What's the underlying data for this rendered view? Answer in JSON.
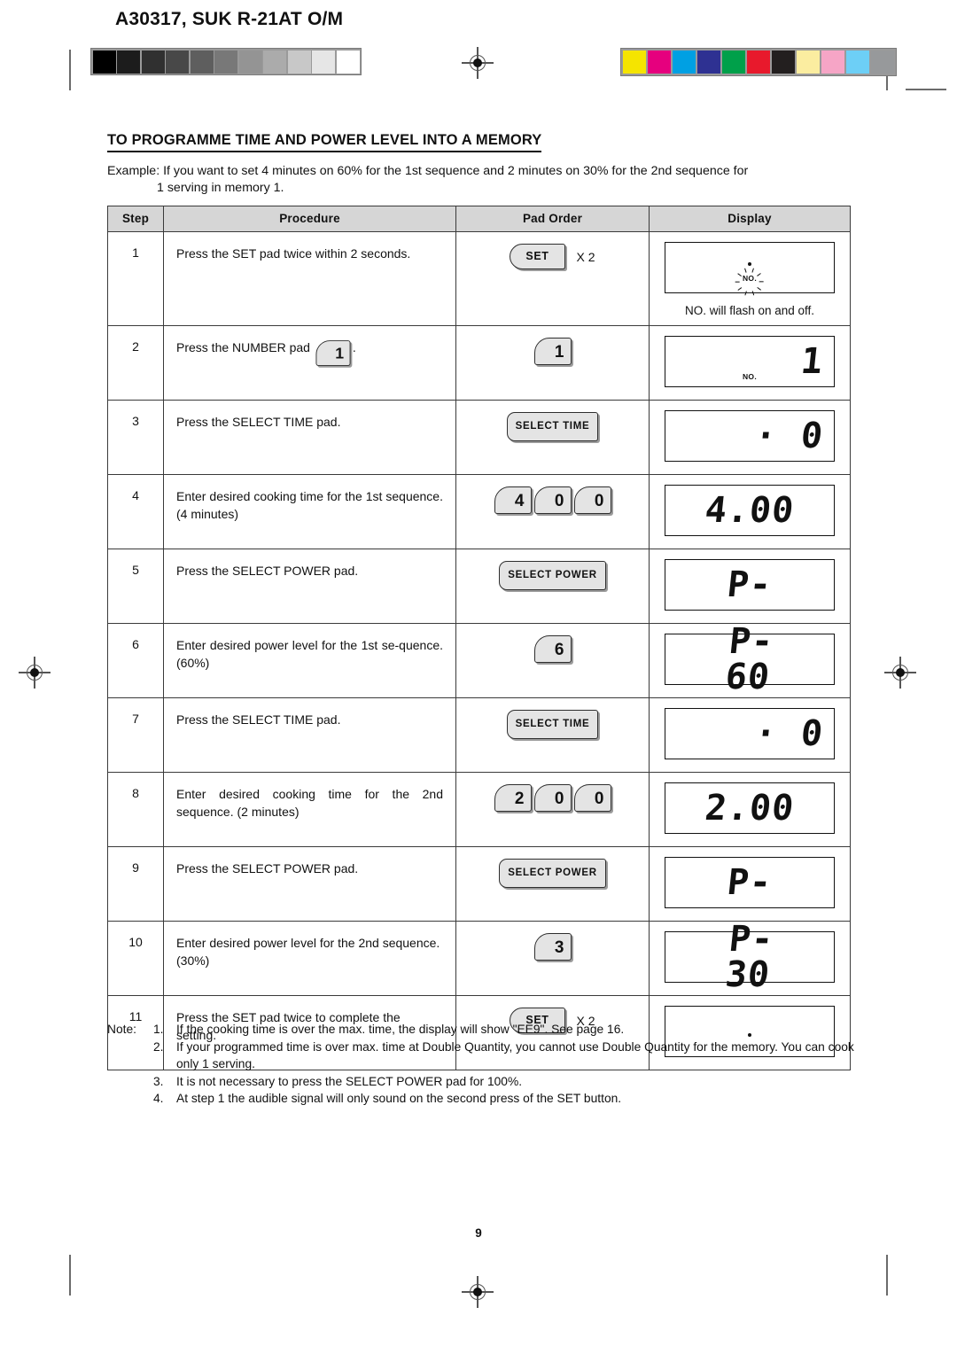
{
  "header": {
    "doc_number": "A30317, SUK R-21AT O/M",
    "page_number": "9"
  },
  "calibration": {
    "gray_patches": [
      "#000000",
      "#1c1c1c",
      "#303030",
      "#484848",
      "#5e5e5e",
      "#787878",
      "#949494",
      "#ababab",
      "#c8c8c8",
      "#e6e6e6",
      "#ffffff"
    ],
    "color_patches": [
      "#f5e400",
      "#e6007e",
      "#00a0e3",
      "#2e3192",
      "#00a04a",
      "#e8192c",
      "#231f1f",
      "#fbeda0",
      "#f6a5c6",
      "#6dcff6",
      "#97999b"
    ]
  },
  "title": "TO PROGRAMME TIME AND POWER LEVEL INTO A MEMORY",
  "example": {
    "line1": "Example: If you want to set 4 minutes on 60% for the 1st sequence and 2 minutes on 30% for the 2nd sequence for",
    "line2": "1 serving in memory 1."
  },
  "table": {
    "headers": [
      "Step",
      "Procedure",
      "Pad Order",
      "Display"
    ],
    "rows": [
      {
        "step": "1",
        "procedure": "Press the SET pad twice within 2 seconds.",
        "justify": false,
        "pad_kind": "set",
        "pad_label": "SET",
        "pad_multiplier": "X 2",
        "display_kind": "flash-no",
        "display_value": "",
        "display_no_label": "NO.",
        "display_caption": "NO. will flash on and off."
      },
      {
        "step": "2",
        "procedure_before": "Press the NUMBER pad",
        "procedure_after": ".",
        "inline_pad": "1",
        "justify": false,
        "pad_kind": "number",
        "pad_digits": [
          "1"
        ],
        "display_kind": "digits-no",
        "display_value": "1",
        "display_no_label": "NO."
      },
      {
        "step": "3",
        "procedure": "Press the SELECT TIME pad.",
        "justify": false,
        "pad_kind": "select",
        "pad_label": "SELECT TIME",
        "display_kind": "dot-digit",
        "display_value": "0"
      },
      {
        "step": "4",
        "procedure": "Enter desired cooking time for the 1st sequence. (4 minutes)",
        "justify": true,
        "pad_kind": "number",
        "pad_digits": [
          "4",
          "0",
          "0"
        ],
        "display_kind": "time",
        "display_value": "4.00"
      },
      {
        "step": "5",
        "procedure": "Press the SELECT POWER pad.",
        "justify": false,
        "pad_kind": "select",
        "pad_label": "SELECT POWER",
        "display_kind": "plain",
        "display_value": "P-"
      },
      {
        "step": "6",
        "procedure": "Enter desired power level for the 1st se-quence. (60%)",
        "justify": true,
        "pad_kind": "number",
        "pad_digits": [
          "6"
        ],
        "display_kind": "plain",
        "display_value": "P-60"
      },
      {
        "step": "7",
        "procedure": "Press the SELECT TIME pad.",
        "justify": false,
        "pad_kind": "select",
        "pad_label": "SELECT TIME",
        "display_kind": "dot-digit",
        "display_value": "0"
      },
      {
        "step": "8",
        "procedure": "Enter desired cooking time for the 2nd sequence. (2 minutes)",
        "justify": true,
        "pad_kind": "number",
        "pad_digits": [
          "2",
          "0",
          "0"
        ],
        "display_kind": "time",
        "display_value": "2.00"
      },
      {
        "step": "9",
        "procedure": "Press the SELECT POWER pad.",
        "justify": false,
        "pad_kind": "select",
        "pad_label": "SELECT POWER",
        "display_kind": "plain",
        "display_value": "P-"
      },
      {
        "step": "10",
        "procedure": "Enter desired power level for the 2nd sequence. (30%)",
        "justify": false,
        "pad_kind": "number",
        "pad_digits": [
          "3"
        ],
        "display_kind": "plain",
        "display_value": "P-30"
      },
      {
        "step": "11",
        "procedure": "Press the SET pad twice to complete the setting.",
        "justify": false,
        "pad_kind": "set",
        "pad_label": "SET",
        "pad_multiplier": "X 2",
        "display_kind": "dot-only",
        "display_value": ""
      }
    ]
  },
  "notes": {
    "label": "Note:",
    "items": [
      {
        "num": "1.",
        "text": "If the cooking time is over the max. time, the display will show \"EE9\". See page 16."
      },
      {
        "num": "2.",
        "text": "If your programmed time is over max. time at Double Quantity, you cannot use Double Quantity for the memory. You can cook only 1 serving."
      },
      {
        "num": "3.",
        "text": "It is not necessary to press the SELECT POWER pad for 100%."
      },
      {
        "num": "4.",
        "text": "At step 1 the audible signal will only sound on the second press of the SET button."
      }
    ]
  }
}
